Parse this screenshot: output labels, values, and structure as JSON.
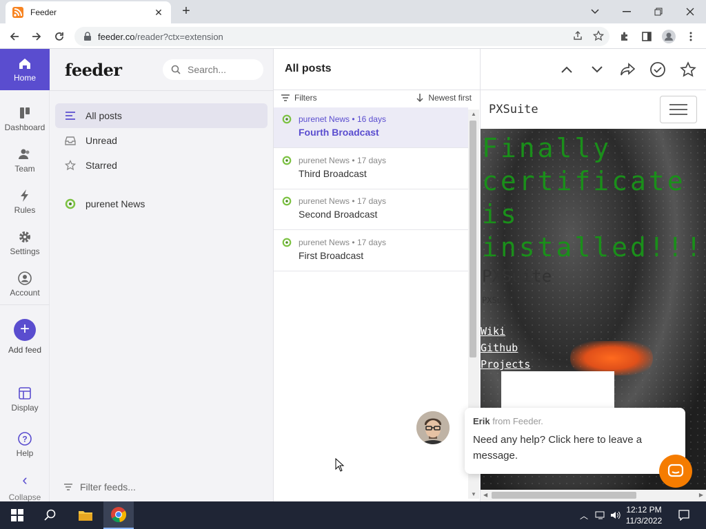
{
  "browser": {
    "tab_title": "Feeder",
    "tab_close": "✕",
    "new_tab": "+",
    "url_domain": "feeder.co",
    "url_path": "/reader?ctx=extension"
  },
  "leftnav": {
    "items": [
      {
        "label": "Home",
        "icon": "home-icon"
      },
      {
        "label": "Dashboard",
        "icon": "dashboard-icon"
      },
      {
        "label": "Team",
        "icon": "team-icon"
      },
      {
        "label": "Rules",
        "icon": "lightning-icon"
      },
      {
        "label": "Settings",
        "icon": "gear-icon"
      },
      {
        "label": "Account",
        "icon": "account-icon"
      }
    ],
    "add_feed": "Add feed",
    "add_feed_symbol": "+",
    "display": "Display",
    "help": "Help",
    "collapse": "Collapse",
    "collapse_symbol": "‹"
  },
  "sidebar": {
    "logo": "feeder",
    "search_placeholder": "Search...",
    "items": [
      {
        "label": "All posts",
        "icon": "list-icon"
      },
      {
        "label": "Unread",
        "icon": "inbox-icon"
      },
      {
        "label": "Starred",
        "icon": "star-icon"
      },
      {
        "label": "purenet News",
        "icon": "feed-favicon"
      }
    ],
    "filter_feeds": "Filter feeds..."
  },
  "postlist": {
    "header": "All posts",
    "filters": "Filters",
    "sort": "Newest first",
    "separator": "•",
    "posts": [
      {
        "source": "purenet News",
        "age": "16 days",
        "title": "Fourth Broadcast"
      },
      {
        "source": "purenet News",
        "age": "17 days",
        "title": "Third Broadcast"
      },
      {
        "source": "purenet News",
        "age": "17 days",
        "title": "Second Broadcast"
      },
      {
        "source": "purenet News",
        "age": "17 days",
        "title": "First Broadcast"
      }
    ]
  },
  "reader": {
    "site_name": "PXSuite",
    "hero_title": "Finally\ncertificate\nis\ninstalled!!!!!",
    "hero_sub": "PXSuite",
    "hero_small": "PXSu",
    "links": [
      "Wiki",
      "Github",
      "Projects"
    ]
  },
  "chat": {
    "from_name": "Erik",
    "from_rest": "from Feeder.",
    "message": "Need any help? Click here to leave a message."
  },
  "taskbar": {
    "time": "12:12 PM",
    "date": "11/3/2022"
  },
  "colors": {
    "accent": "#5a4dcf",
    "feed_icon": "#7cc242",
    "hero_green": "#1a8f1a",
    "chat_orange": "#f57c00"
  }
}
